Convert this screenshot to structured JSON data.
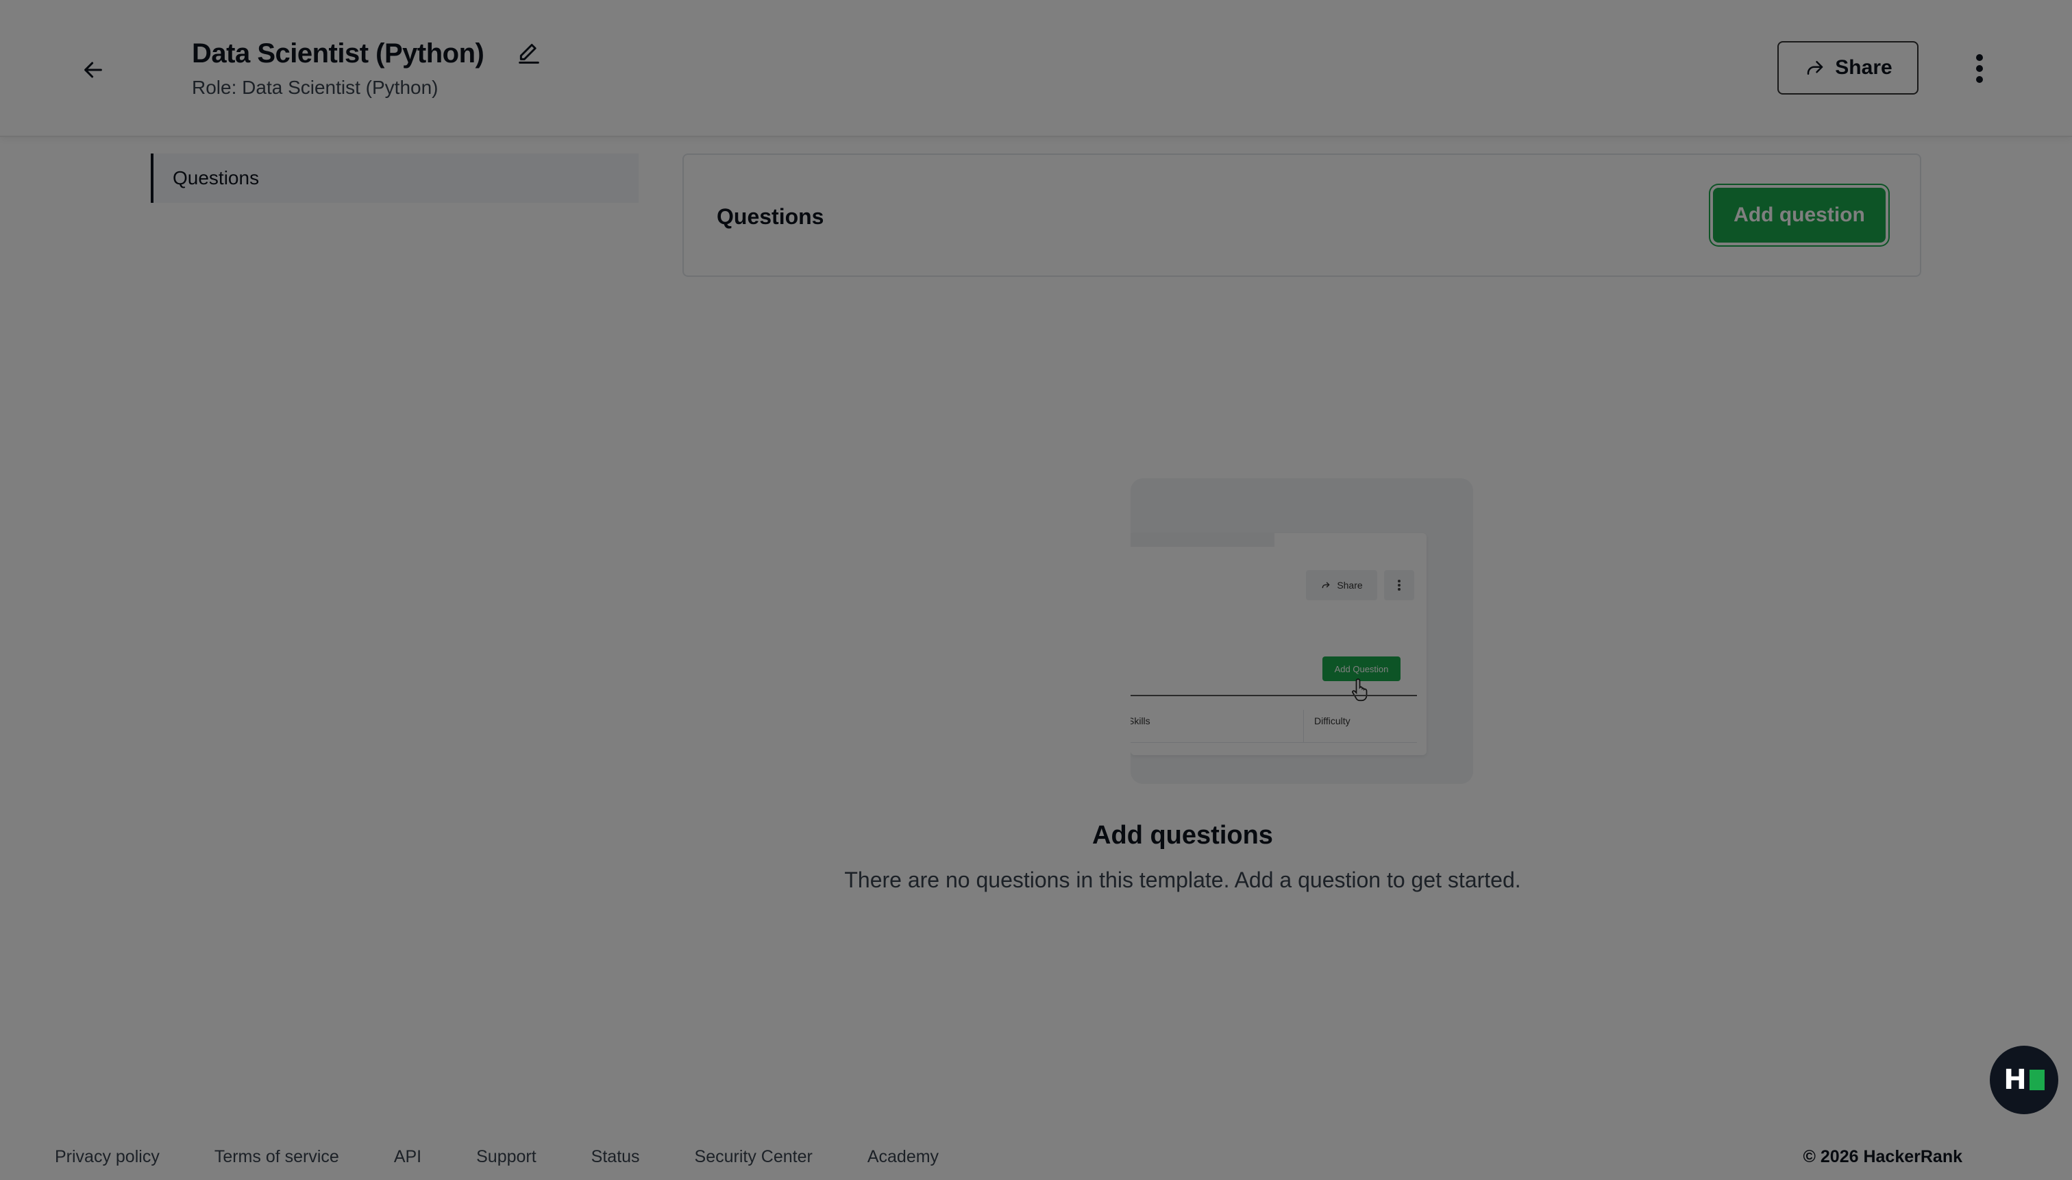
{
  "header": {
    "title": "Data Scientist (Python)",
    "subtitle": "Role: Data Scientist (Python)",
    "share_label": "Share",
    "icons": [
      "arrow-left-icon",
      "pencil-icon",
      "share-arrow-icon",
      "kebab-icon"
    ]
  },
  "sidebar": {
    "items": [
      {
        "label": "Questions",
        "active": true
      }
    ]
  },
  "main": {
    "panel_title": "Questions",
    "add_question_label": "Add question",
    "illustration": {
      "share_label": "Share",
      "add_label": "Add Question",
      "col_skills": "Skills",
      "col_difficulty": "Difficulty"
    },
    "empty_title": "Add questions",
    "empty_subtitle": "There are no questions in this template. Add a question to get started."
  },
  "footer": {
    "links": [
      "Privacy policy",
      "Terms of service",
      "API",
      "Support",
      "Status",
      "Security Center",
      "Academy"
    ],
    "copyright": "© 2026 HackerRank"
  },
  "colors": {
    "accent_green": "#1ba94c",
    "text_dark": "#0e141e",
    "overlay": "rgba(0,0,0,0.5)"
  }
}
